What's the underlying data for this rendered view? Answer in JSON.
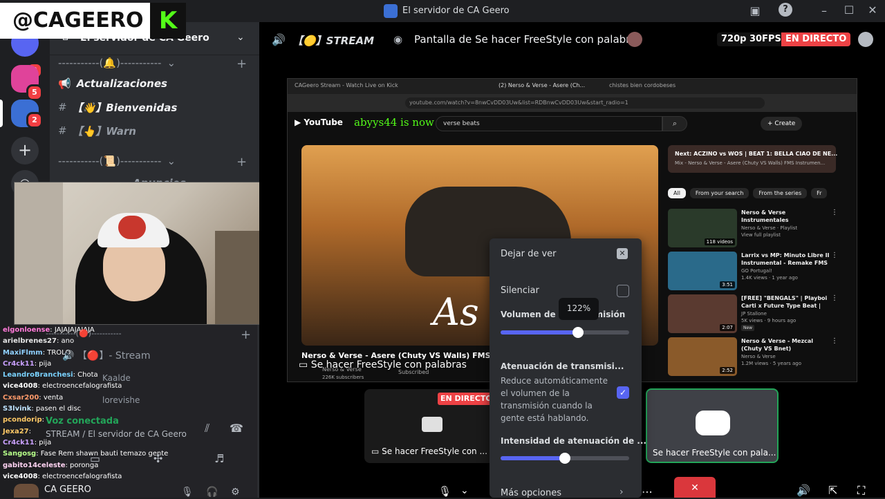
{
  "overlay": {
    "handle": "@CAGEERO",
    "kick_logo": "K"
  },
  "titlebar": {
    "title": "El servidor de CA Geero"
  },
  "servers": {
    "badges": [
      "2",
      "5",
      "2"
    ]
  },
  "channels": {
    "server_name": "El servidor de CA Geero",
    "category_1": "-----------(🔔)-----------",
    "items": [
      "Actualizaciones",
      "【👋】Bienvenidas",
      "【👆】Warn"
    ],
    "category_2": "-----------(📜)-----------",
    "partial_item": "Anuncios",
    "category_3": "-----------(🔴)-----------",
    "voice_channel": "【🔴】- Stream",
    "voice_users": [
      "Kaalde",
      "lorevishe"
    ],
    "voice_status": "Voz conectada",
    "voice_location": "STREAM / El servidor de CA Geero",
    "user_name": "CA GEERO"
  },
  "chat": [
    {
      "user": "elgonloense",
      "text": ": JAJAJAJAJAJA"
    },
    {
      "user": "arielbrenes27",
      "text": ": ano"
    },
    {
      "user": "MaxiFlmm",
      "text": ": TROLO"
    },
    {
      "user": "Cr4ck11",
      "text": ": pija"
    },
    {
      "user": "LeandroBranchesi",
      "text": ": Chota"
    },
    {
      "user": "vice4008",
      "text": ": electroencefalografista"
    },
    {
      "user": "Cxsar200",
      "text": ": venta"
    },
    {
      "user": "S3lvink",
      "text": ": pasen el disc"
    },
    {
      "user": "pcondorip",
      "text": ": "
    },
    {
      "user": "Jexa27",
      "text": ": "
    },
    {
      "user": "Cr4ck11",
      "text": ": pija"
    },
    {
      "user": "Sangosg",
      "text": ": Fase Rem shawn bauti temazo gente"
    },
    {
      "user": "gabito14celeste",
      "text": ": poronga"
    },
    {
      "user": "vice4008",
      "text": ": electroencefalografista"
    }
  ],
  "stage": {
    "channel_label": "【🟡】STREAM",
    "stream_title": "Pantalla de Se hacer FreeStyle con palabras",
    "quality": "720p 30FPS",
    "live": "EN DIRECTO",
    "main_caption": "Se hacer FreeStyle con palabras",
    "tile1_live": "EN DIRECTO",
    "tile1_caption": "Se hacer FreeStyle con ...",
    "tile2_caption": "Se hacer FreeStyle con pala..."
  },
  "browser": {
    "tabs": [
      "CAGeero Stream - Watch Live on Kick",
      "(2) Nerso & Verse - Asere (Ch...",
      "chistes bien cordobeses"
    ],
    "url": "youtube.com/watch?v=8nwCvDD03Uw&list=RDBnwCvDD03Uw&start_radio=1",
    "search": "verse beats",
    "create": "Create",
    "follow_toast": "abyys44 is now following!",
    "video_title": "Nerso & Verse - Asere (Chuty VS Walls) FMS Instru...",
    "channel": "Nerso & Verse",
    "subs": "226K subscribers",
    "subscribed": "Subscribed",
    "next_title": "Next: ACZINO vs WOS | BEAT 1: BELLA CIAO DE NE...",
    "next_sub": "Mix - Nerso & Verse - Asere (Chuty VS Walls) FMS Instrumen...",
    "chips": [
      "All",
      "From your search",
      "From the series",
      "Fr"
    ],
    "recs": [
      {
        "title": "Nerso & Verse Instrumentales",
        "meta1": "Nerso & Verse · Playlist",
        "meta2": "View full playlist",
        "badge": "118 videos"
      },
      {
        "title": "Larrix vs MP: Minuto Libre II Instrumental - Remake FMS ...",
        "meta1": "GO Portugal!",
        "meta2": "1.4K views · 1 year ago",
        "badge": "3:51"
      },
      {
        "title": "[FREE] \"BENGALS\" | Playboi Carti x Future Type Beat | Dark...",
        "meta1": "JP Stallone",
        "meta2": "5K views · 9 hours ago",
        "badge": "2:07"
      },
      {
        "title": "Nerso & Verse - Mezcal (Chuty VS Bnet) Instrumental Minuto ...",
        "meta1": "Nerso & Verse",
        "meta2": "1.2M views · 5 years ago",
        "badge": "2:52"
      }
    ],
    "new_label": "New",
    "video_overlay": "As"
  },
  "popup": {
    "stop": "Dejar de ver",
    "mute": "Silenciar",
    "volume_label": "Volumen de la transmisión",
    "volume_tooltip": "122%",
    "volume_fraction": 0.6,
    "atten_title": "Atenuación de transmisi...",
    "atten_desc": "Reduce automáticamente el volumen de la transmisión cuando la gente está hablando.",
    "intensity_label": "Intensidad de atenuación de ...",
    "intensity_fraction": 0.5,
    "more": "Más opciones"
  },
  "colors": {
    "accent": "#5865f2",
    "live_red": "#ed4245",
    "green": "#23a559"
  }
}
